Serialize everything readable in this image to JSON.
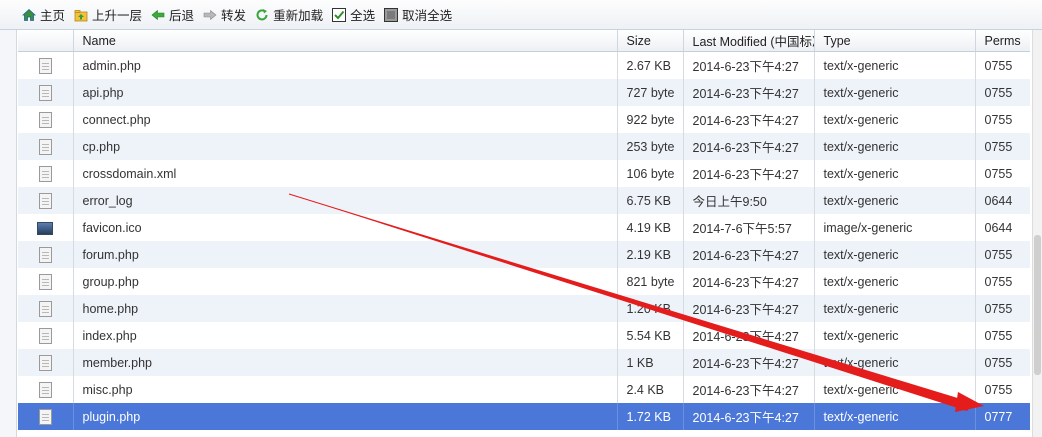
{
  "toolbar": {
    "items": [
      {
        "label": "主页",
        "icon": "home-icon"
      },
      {
        "label": "上升一层",
        "icon": "folder-up-icon"
      },
      {
        "label": "后退",
        "icon": "arrow-left-icon"
      },
      {
        "label": "转发",
        "icon": "arrow-right-icon"
      },
      {
        "label": "重新加载",
        "icon": "reload-icon"
      },
      {
        "label": "全选",
        "icon": "checkbox-checked-icon"
      },
      {
        "label": "取消全选",
        "icon": "checkbox-unchecked-icon"
      }
    ]
  },
  "table": {
    "columns": [
      "Name",
      "Size",
      "Last Modified (中国标准",
      "Type",
      "Perms"
    ],
    "rows": [
      {
        "name": "admin.php",
        "size": "2.67 KB",
        "modified": "2014-6-23下午4:27",
        "type": "text/x-generic",
        "perms": "0755",
        "icon": "file-icon",
        "selected": false
      },
      {
        "name": "api.php",
        "size": "727 byte",
        "modified": "2014-6-23下午4:27",
        "type": "text/x-generic",
        "perms": "0755",
        "icon": "file-icon",
        "selected": false
      },
      {
        "name": "connect.php",
        "size": "922 byte",
        "modified": "2014-6-23下午4:27",
        "type": "text/x-generic",
        "perms": "0755",
        "icon": "file-icon",
        "selected": false
      },
      {
        "name": "cp.php",
        "size": "253 byte",
        "modified": "2014-6-23下午4:27",
        "type": "text/x-generic",
        "perms": "0755",
        "icon": "file-icon",
        "selected": false
      },
      {
        "name": "crossdomain.xml",
        "size": "106 byte",
        "modified": "2014-6-23下午4:27",
        "type": "text/x-generic",
        "perms": "0755",
        "icon": "file-icon",
        "selected": false
      },
      {
        "name": "error_log",
        "size": "6.75 KB",
        "modified": "今日上午9:50",
        "type": "text/x-generic",
        "perms": "0644",
        "icon": "file-icon",
        "selected": false
      },
      {
        "name": "favicon.ico",
        "size": "4.19 KB",
        "modified": "2014-7-6下午5:57",
        "type": "image/x-generic",
        "perms": "0644",
        "icon": "image-file-icon",
        "selected": false
      },
      {
        "name": "forum.php",
        "size": "2.19 KB",
        "modified": "2014-6-23下午4:27",
        "type": "text/x-generic",
        "perms": "0755",
        "icon": "file-icon",
        "selected": false
      },
      {
        "name": "group.php",
        "size": "821 byte",
        "modified": "2014-6-23下午4:27",
        "type": "text/x-generic",
        "perms": "0755",
        "icon": "file-icon",
        "selected": false
      },
      {
        "name": "home.php",
        "size": "1.20 KB",
        "modified": "2014-6-23下午4:27",
        "type": "text/x-generic",
        "perms": "0755",
        "icon": "file-icon",
        "selected": false
      },
      {
        "name": "index.php",
        "size": "5.54 KB",
        "modified": "2014-6-23下午4:27",
        "type": "text/x-generic",
        "perms": "0755",
        "icon": "file-icon",
        "selected": false
      },
      {
        "name": "member.php",
        "size": "1 KB",
        "modified": "2014-6-23下午4:27",
        "type": "text/x-generic",
        "perms": "0755",
        "icon": "file-icon",
        "selected": false
      },
      {
        "name": "misc.php",
        "size": "2.4 KB",
        "modified": "2014-6-23下午4:27",
        "type": "text/x-generic",
        "perms": "0755",
        "icon": "file-icon",
        "selected": false
      },
      {
        "name": "plugin.php",
        "size": "1.72 KB",
        "modified": "2014-6-23下午4:27",
        "type": "text/x-generic",
        "perms": "0777",
        "icon": "file-icon",
        "selected": true
      }
    ]
  },
  "colors": {
    "selected_row": "#4a77d8",
    "alt_row": "#eef3fa",
    "annotation_arrow": "#e51c1c"
  }
}
